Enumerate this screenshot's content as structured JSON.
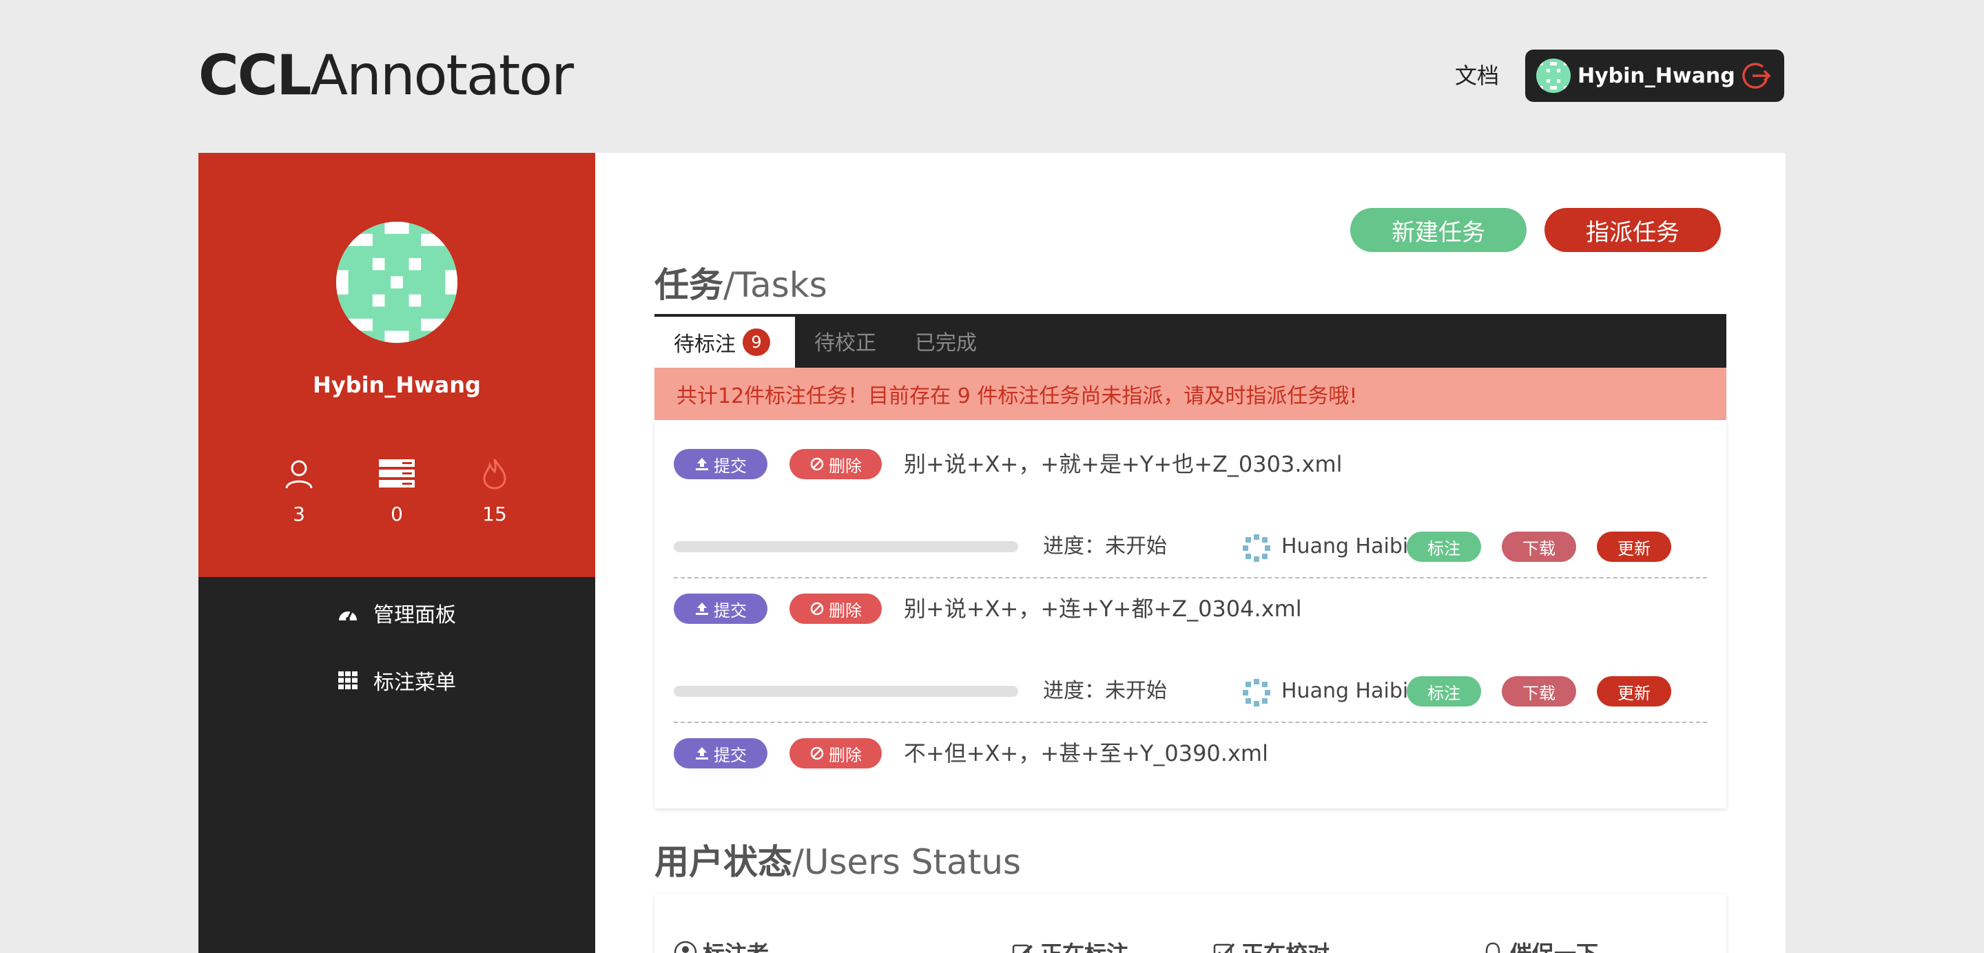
{
  "header": {
    "brand_bold": "CCL",
    "brand_light": "Annotator",
    "docs_link": "文档",
    "user_name": "Hybin_Hwang"
  },
  "sidebar": {
    "user_name": "Hybin_Hwang",
    "stats": [
      {
        "icon": "user-icon",
        "value": "3"
      },
      {
        "icon": "server-icon",
        "value": "0"
      },
      {
        "icon": "fire-icon",
        "value": "15"
      }
    ],
    "nav": [
      {
        "icon": "dashboard-icon",
        "label": "管理面板"
      },
      {
        "icon": "grid-icon",
        "label": "标注菜单"
      }
    ]
  },
  "main": {
    "new_task_button": "新建任务",
    "assign_task_button": "指派任务",
    "tasks_title_cn": "任务",
    "tasks_title_en": "/Tasks",
    "tabs": [
      {
        "label": "待标注",
        "badge": "9"
      },
      {
        "label": "待校正"
      },
      {
        "label": "已完成"
      }
    ],
    "alert": "共计12件标注任务！目前存在 9 件标注任务尚未指派，请及时指派任务哦!",
    "tasks": [
      {
        "submit": "提交",
        "delete": "删除",
        "file": "别+说+X+，+就+是+Y+也+Z_0303.xml",
        "progress": "进度：未开始",
        "progress_fraction": 0,
        "assignee": "Huang Haibin",
        "mark": "标注",
        "download": "下载",
        "update": "更新"
      },
      {
        "submit": "提交",
        "delete": "删除",
        "file": "别+说+X+，+连+Y+都+Z_0304.xml",
        "progress": "进度：未开始",
        "progress_fraction": 0,
        "assignee": "Huang Haibin",
        "mark": "标注",
        "download": "下载",
        "update": "更新"
      },
      {
        "submit": "提交",
        "delete": "删除",
        "file": "不+但+X+，+甚+至+Y_0390.xml"
      }
    ],
    "users_title_cn": "用户状态",
    "users_title_en": "/Users Status",
    "users_headers": [
      {
        "icon": "user-circle-icon",
        "label": "标注者"
      },
      {
        "icon": "edit-icon",
        "label": "正在标注"
      },
      {
        "icon": "check-square-icon",
        "label": "正在校对"
      },
      {
        "icon": "bell-icon",
        "label": "催促一下"
      }
    ]
  },
  "colors": {
    "brand_red": "#c8301f",
    "green": "#66c58a",
    "purple": "#7a6ac8",
    "dark": "#232323"
  }
}
